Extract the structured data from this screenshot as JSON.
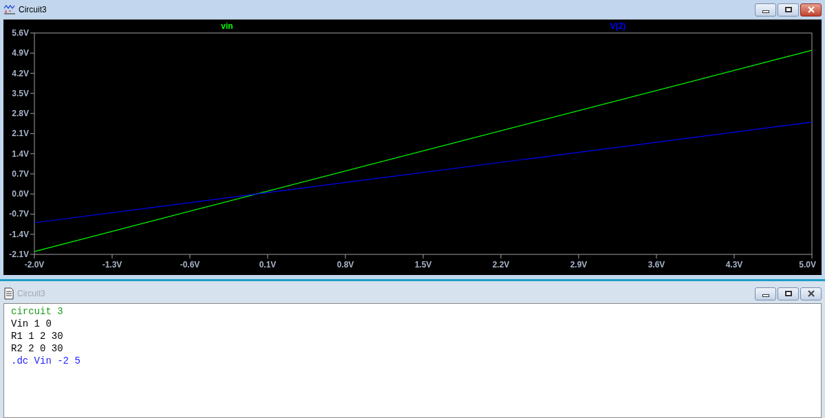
{
  "plot_window": {
    "title": "Circuit3",
    "active": true,
    "chart_data": {
      "type": "line",
      "x": [
        -2,
        5
      ],
      "series": [
        {
          "name": "vin",
          "color": "#00ff00",
          "values": [
            -2,
            5
          ]
        },
        {
          "name": "V(2)",
          "color": "#0000ff",
          "values": [
            -1,
            2.5
          ]
        }
      ],
      "xlim": [
        -2,
        5
      ],
      "ylim": [
        -2.1,
        5.6
      ],
      "xticks": [
        {
          "value": -2,
          "label": "-2.0V"
        },
        {
          "value": -1.3,
          "label": "-1.3V"
        },
        {
          "value": -0.6,
          "label": "-0.6V"
        },
        {
          "value": 0.1,
          "label": "0.1V"
        },
        {
          "value": 0.8,
          "label": "0.8V"
        },
        {
          "value": 1.5,
          "label": "1.5V"
        },
        {
          "value": 2.2,
          "label": "2.2V"
        },
        {
          "value": 2.9,
          "label": "2.9V"
        },
        {
          "value": 3.6,
          "label": "3.6V"
        },
        {
          "value": 4.3,
          "label": "4.3V"
        },
        {
          "value": 5,
          "label": "5.0V"
        }
      ],
      "yticks": [
        {
          "value": 5.6,
          "label": "5.6V"
        },
        {
          "value": 4.9,
          "label": "4.9V"
        },
        {
          "value": 4.2,
          "label": "4.2V"
        },
        {
          "value": 3.5,
          "label": "3.5V"
        },
        {
          "value": 2.8,
          "label": "2.8V"
        },
        {
          "value": 2.1,
          "label": "2.1V"
        },
        {
          "value": 1.4,
          "label": "1.4V"
        },
        {
          "value": 0.7,
          "label": "0.7V"
        },
        {
          "value": 0,
          "label": "0.0V"
        },
        {
          "value": -0.7,
          "label": "-0.7V"
        },
        {
          "value": -1.4,
          "label": "-1.4V"
        },
        {
          "value": -2.1,
          "label": "-2.1V"
        }
      ]
    }
  },
  "netlist_window": {
    "title": "Circuit3",
    "active": false,
    "lines": [
      {
        "kind": "comment",
        "text": "circuit 3"
      },
      {
        "kind": "element",
        "text": "Vin 1 0"
      },
      {
        "kind": "element",
        "text": "R1 1 2 30"
      },
      {
        "kind": "element",
        "text": "R2 2 0 30"
      },
      {
        "kind": "directive",
        "text": ".dc Vin -2 5"
      }
    ]
  }
}
